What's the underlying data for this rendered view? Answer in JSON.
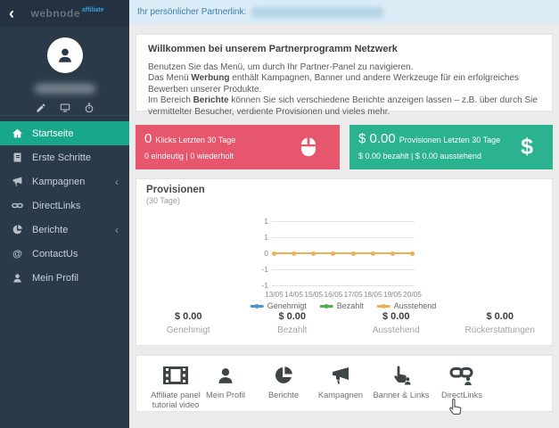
{
  "topbar": {
    "partner_link_label": "Ihr persönlicher Partnerlink:"
  },
  "sidebar": {
    "logo": "webnode",
    "logo_suffix": "affiliate",
    "back_chevron": "‹",
    "at_glyph": "@",
    "menu": [
      {
        "label": "Startseite"
      },
      {
        "label": "Erste Schritte"
      },
      {
        "label": "Kampagnen",
        "chevron": "‹"
      },
      {
        "label": "DirectLinks"
      },
      {
        "label": "Berichte",
        "chevron": "‹"
      },
      {
        "label": "ContactUs"
      },
      {
        "label": "Mein Profil"
      }
    ]
  },
  "welcome": {
    "title": "Willkommen bei unserem Partnerprogramm Netzwerk",
    "line1": "Benutzen Sie das Menü, um durch Ihr Partner-Panel zu navigieren.",
    "line2_pre": "Das Menü ",
    "line2_bold": "Werbung",
    "line2_post": " enthält Kampagnen, Banner und andere Werkzeuge für ein erfolgreiches Bewerben unserer Produkte.",
    "line3_pre": "Im Bereich ",
    "line3_bold": "Berichte",
    "line3_post": " können Sie sich verschiedene Berichte anzeigen lassen – z.B. über durch Sie vermittelter Besucher, verdiente Provisionen und vieles mehr."
  },
  "stats": {
    "clicks": {
      "value": "0",
      "label": "Klicks Letzten 30 Tage",
      "sub": "0 eindeutig | 0 wiederholt",
      "color": "#e6566c"
    },
    "commissions": {
      "value": "$ 0.00",
      "label": "Provisionen Letzten 30 Tage",
      "sub": "$ 0.00 bezahlt | $ 0.00 ausstehend",
      "currency_symbol": "$",
      "color": "#2bb28e"
    }
  },
  "chart_data": {
    "type": "line",
    "title": "Provisionen",
    "subtitle": "(30 Tage)",
    "x": [
      "13/05",
      "14/05",
      "15/05",
      "16/05",
      "17/05",
      "18/05",
      "19/05",
      "20/05"
    ],
    "y_tick_labels": [
      "1",
      "1",
      "0",
      "-1",
      "-1"
    ],
    "ylim": [
      -1,
      1
    ],
    "grid": true,
    "legend_position": "bottom",
    "series": [
      {
        "name": "Genehmigt",
        "color": "#4a94d0",
        "values": [
          0,
          0,
          0,
          0,
          0,
          0,
          0,
          0
        ]
      },
      {
        "name": "Bezahlt",
        "color": "#52b152",
        "values": [
          0,
          0,
          0,
          0,
          0,
          0,
          0,
          0
        ]
      },
      {
        "name": "Ausstehend",
        "color": "#eeb057",
        "values": [
          0,
          0,
          0,
          0,
          0,
          0,
          0,
          0
        ]
      }
    ]
  },
  "totals": [
    {
      "value": "$ 0.00",
      "label": "Genehmigt"
    },
    {
      "value": "$ 0.00",
      "label": "Bezahlt"
    },
    {
      "value": "$ 0.00",
      "label": "Ausstehend"
    },
    {
      "value": "$ 0.00",
      "label": "Rückerstattungen"
    }
  ],
  "shortcuts": [
    {
      "label": "Affiliate panel tutorial video"
    },
    {
      "label": "Mein Profil"
    },
    {
      "label": "Berichte"
    },
    {
      "label": "Kampagnen"
    },
    {
      "label": "Banner & Links"
    },
    {
      "label": "DirectLinks"
    }
  ],
  "colors": {
    "accent_teal": "#18a78b",
    "stat_red": "#e6566c",
    "stat_green": "#2bb28e",
    "topbar_blue": "#daedf6",
    "sidebar_dark": "#2b3a48"
  }
}
